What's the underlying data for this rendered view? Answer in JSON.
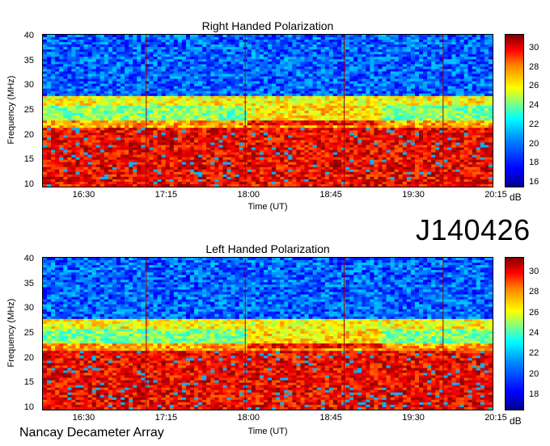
{
  "observation_id": "J140426",
  "footer": "Nancay Decameter Array",
  "chart_data": [
    {
      "type": "heatmap",
      "title": "Right Handed Polarization",
      "xlabel": "Time (UT)",
      "ylabel": "Frequency (MHz)",
      "xticks": [
        "16:30",
        "17:15",
        "18:00",
        "18:45",
        "19:30",
        "20:15"
      ],
      "yticks": [
        10,
        15,
        20,
        25,
        30,
        35,
        40
      ],
      "ylim": [
        9.5,
        40.5
      ],
      "colorbar": {
        "label": "dB",
        "ticks": [
          16,
          18,
          20,
          22,
          24,
          26,
          28,
          30
        ],
        "range": [
          15.5,
          31.5
        ]
      }
    },
    {
      "type": "heatmap",
      "title": "Left Handed Polarization",
      "xlabel": "Time (UT)",
      "ylabel": "Frequency (MHz)",
      "xticks": [
        "16:30",
        "17:15",
        "18:00",
        "18:45",
        "19:30",
        "20:15"
      ],
      "yticks": [
        10,
        15,
        20,
        25,
        30,
        35,
        40
      ],
      "ylim": [
        9.5,
        40.5
      ],
      "colorbar": {
        "label": "dB",
        "ticks": [
          18,
          20,
          22,
          24,
          26,
          28,
          30
        ],
        "range": [
          16.5,
          31.5
        ]
      }
    }
  ]
}
